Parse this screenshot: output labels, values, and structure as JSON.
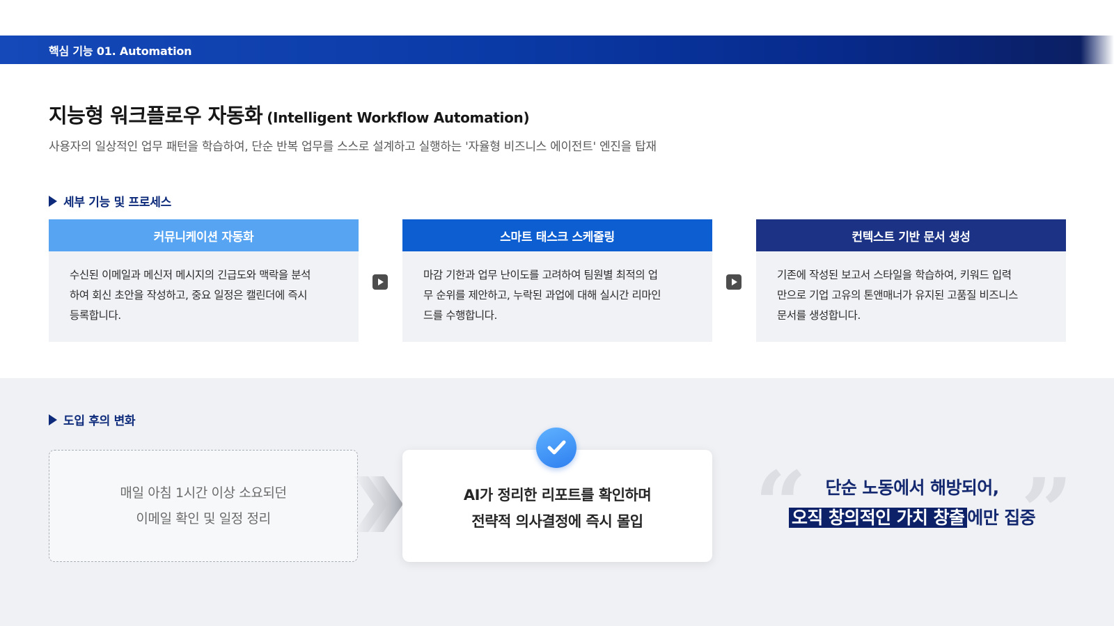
{
  "banner": {
    "label": "핵심 기능 01. Automation"
  },
  "header": {
    "title_ko": "지능형 워크플로우 자동화",
    "title_en": "(Intelligent Workflow Automation)",
    "subtitle": "사용자의 일상적인 업무 패턴을 학습하여, 단순 반복 업무를 스스로 설계하고 실행하는 '자율형 비즈니스 에이전트' 엔진을 탑재"
  },
  "process": {
    "heading": "세부 기능 및 프로세스",
    "cards": [
      {
        "title": "커뮤니케이션 자동화",
        "lines": [
          "수신된 이메일과 메신저 메시지의 긴급도와 맥락을 분석",
          "하여 회신 초안을 작성하고, 중요 일정은 캘린더에 즉시",
          "등록합니다."
        ],
        "color": "#57a4f2"
      },
      {
        "title": "스마트 태스크 스케줄링",
        "lines": [
          "마감 기한과 업무 난이도를 고려하여 팀원별 최적의 업",
          "무 순위를 제안하고, 누락된 과업에 대해 실시간 리마인",
          "드를 수행합니다."
        ],
        "color": "#0d5fd1"
      },
      {
        "title": "컨텍스트 기반 문서 생성",
        "lines": [
          "기존에 작성된 보고서 스타일을 학습하여, 키워드 입력",
          "만으로 기업 고유의 톤앤매너가 유지된 고품질 비즈니스",
          "문서를 생성합니다."
        ],
        "color": "#1c3385"
      }
    ]
  },
  "change": {
    "heading": "도입 후의 변화",
    "before_lines": [
      "매일 아침 1시간 이상 소요되던",
      "이메일 확인 및 일정 정리"
    ],
    "after_lines": [
      "AI가 정리한 리포트를 확인하며",
      "전략적 의사결정에 즉시 몰입"
    ],
    "message_line1": "단순 노동에서 해방되어,",
    "message_highlight": "오직 창의적인 가치 창출",
    "message_rest": "에만 집중",
    "quote_open": "“",
    "quote_close": "”"
  }
}
